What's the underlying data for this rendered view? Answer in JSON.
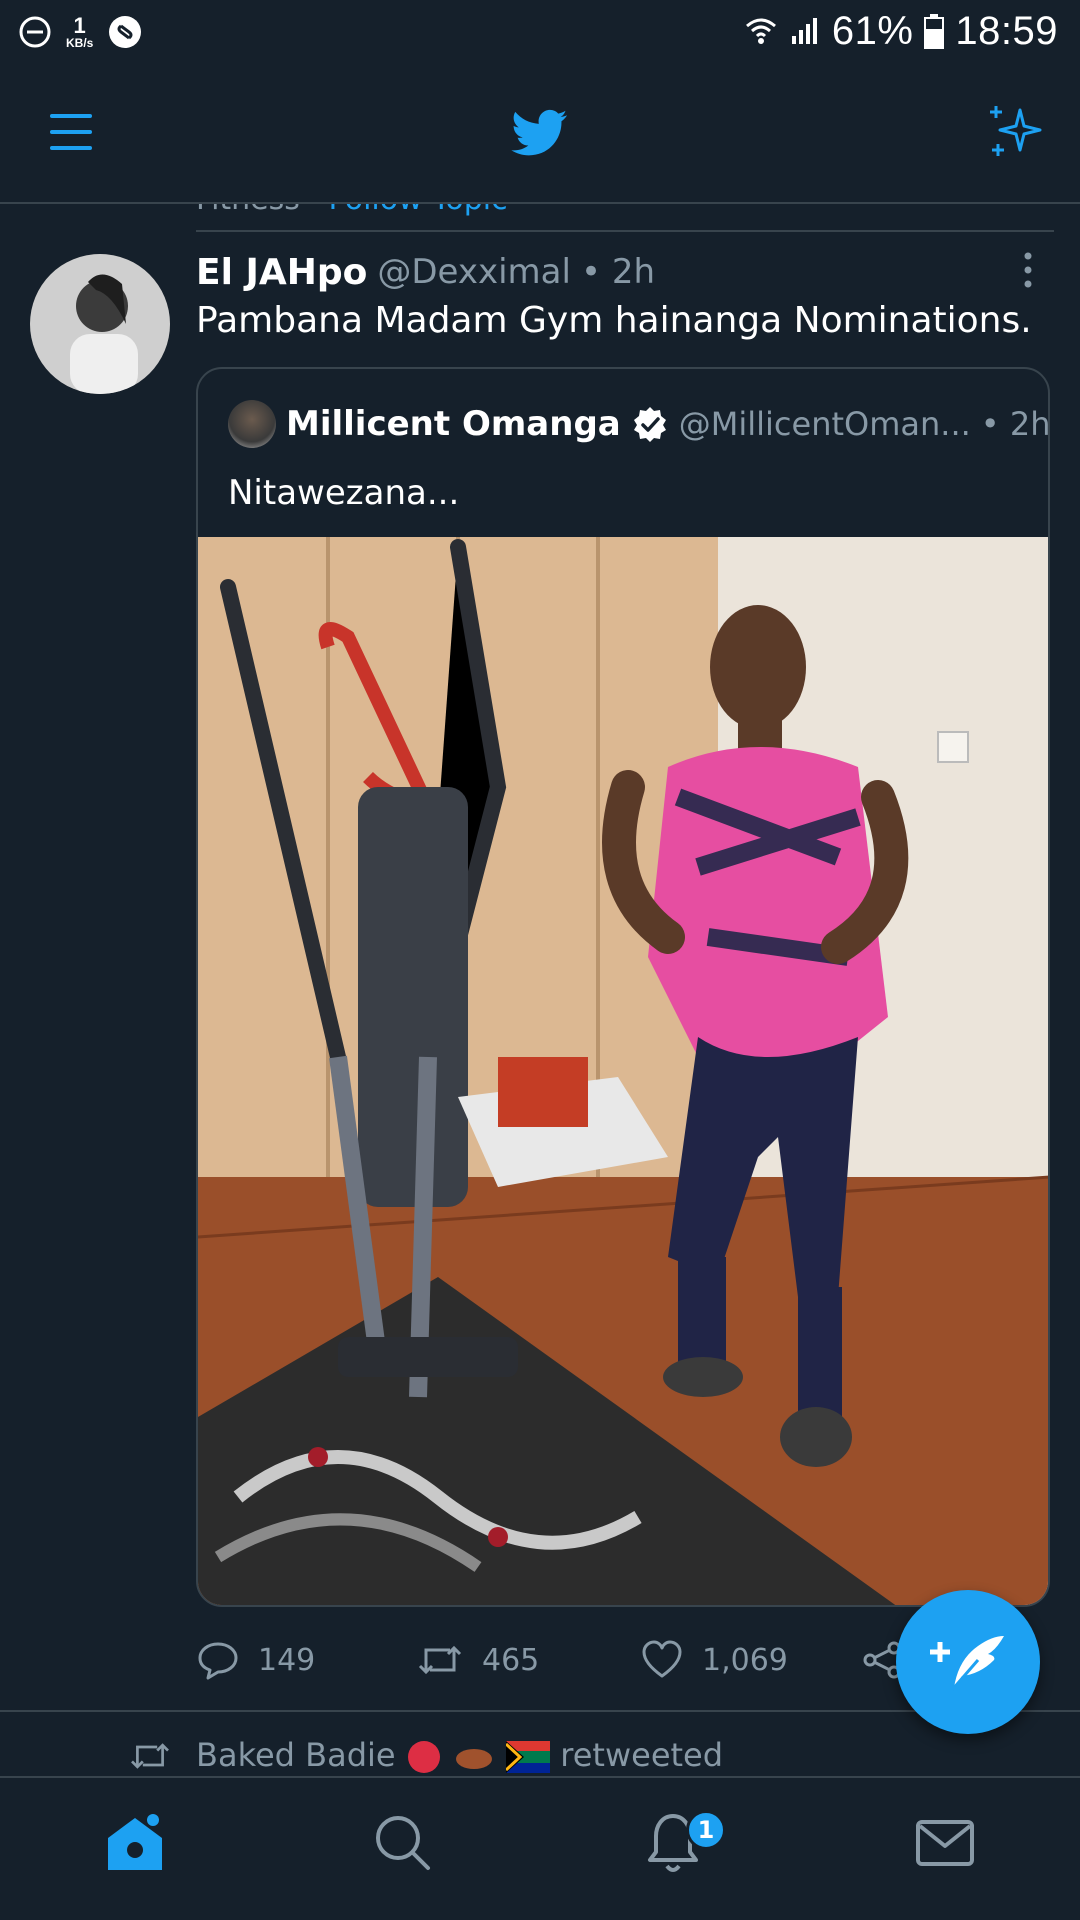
{
  "status_bar": {
    "speed_value": "1",
    "speed_unit": "KB/s",
    "battery": "61%",
    "time": "18:59"
  },
  "context": {
    "topic_text": "Fitness",
    "follow_label": "Follow Topic"
  },
  "tweet": {
    "display_name": "El JAHpo",
    "handle": "@Dexximal",
    "time": "• 2h",
    "text": "Pambana Madam Gym hainanga Nominations.",
    "quote": {
      "display_name": "Millicent Omanga",
      "handle": "@MillicentOman...",
      "time": "• 2h",
      "text": "Nitawezana..."
    },
    "actions": {
      "replies": "149",
      "retweets": "465",
      "likes": "1,069"
    }
  },
  "next_item": {
    "retweeted_by": "Baked Badie",
    "retweeted_suffix": "retweeted"
  },
  "bottom_nav": {
    "notifications_badge": "1"
  },
  "colors": {
    "background": "#15202b",
    "accent": "#1da1f2",
    "divider": "#38444d",
    "secondary_text": "#8899a6"
  },
  "icons": [
    "do-not-disturb-icon",
    "shazam-icon",
    "wifi-icon",
    "signal-icon",
    "battery-icon",
    "menu-icon",
    "twitter-logo-icon",
    "sparkle-icon",
    "more-vertical-icon",
    "verified-icon",
    "reply-icon",
    "retweet-icon",
    "like-icon",
    "share-icon",
    "compose-icon",
    "home-icon",
    "search-icon",
    "notifications-icon",
    "messages-icon"
  ]
}
